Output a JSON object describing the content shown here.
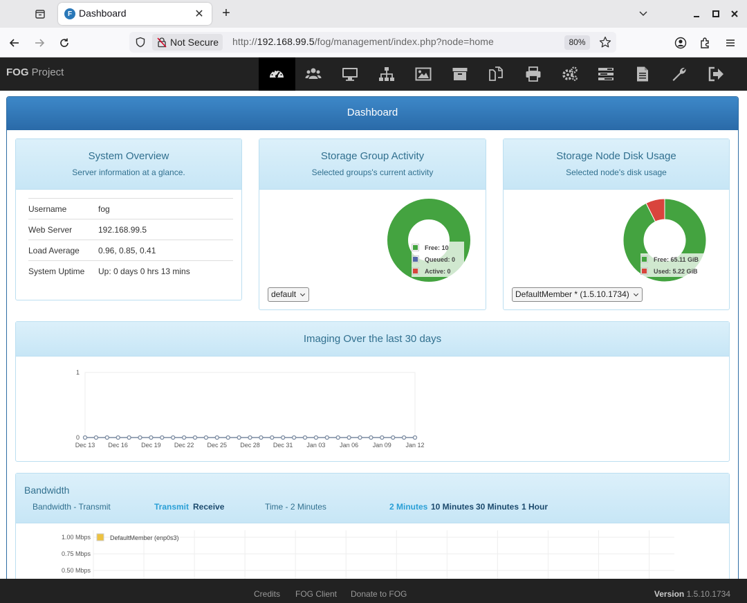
{
  "browser": {
    "tab_title": "Dashboard",
    "tab_favicon": "F",
    "not_secure_label": "Not Secure",
    "url_prefix": "http://",
    "url_host": "192.168.99.5",
    "url_path": "/fog/management/index.php?node=home",
    "zoom": "80%"
  },
  "header": {
    "brand_bold": "FOG",
    "brand_rest": " Project",
    "menu": [
      {
        "icon": "dashboard-icon",
        "active": true
      },
      {
        "icon": "users-icon"
      },
      {
        "icon": "hosts-icon"
      },
      {
        "icon": "groups-icon"
      },
      {
        "icon": "images-icon"
      },
      {
        "icon": "storage-icon"
      },
      {
        "icon": "snapins-icon"
      },
      {
        "icon": "printers-icon"
      },
      {
        "icon": "service-icon"
      },
      {
        "icon": "tasks-icon"
      },
      {
        "icon": "reports-icon"
      },
      {
        "icon": "settings-icon"
      },
      {
        "icon": "logout-icon"
      }
    ]
  },
  "dashboard": {
    "heading": "Dashboard",
    "system_overview": {
      "title": "System Overview",
      "subtitle": "Server information at a glance.",
      "rows": [
        {
          "key": "Username",
          "value": "fog"
        },
        {
          "key": "Web Server",
          "value": "192.168.99.5"
        },
        {
          "key": "Load Average",
          "value": "0.96, 0.85, 0.41"
        },
        {
          "key": "System Uptime",
          "value": "Up: 0 days 0 hrs 13 mins"
        }
      ]
    },
    "storage_group": {
      "title": "Storage Group Activity",
      "subtitle": "Selected groups's current activity",
      "select_value": "default",
      "legend": [
        "Free: 10",
        "Queued: 0",
        "Active: 0"
      ],
      "colors": [
        "#44a340",
        "#5566aa",
        "#d9443d"
      ]
    },
    "storage_node": {
      "title": "Storage Node Disk Usage",
      "subtitle": "Selected node's disk usage",
      "select_value": "DefaultMember * (1.5.10.1734)",
      "legend": [
        "Free: 65.11 GiB",
        "Used: 5.22 GiB"
      ],
      "colors": [
        "#44a340",
        "#d9443d"
      ]
    },
    "imaging": {
      "title": "Imaging Over the last 30 days"
    },
    "bandwidth": {
      "title": "Bandwidth",
      "label_transmit": "Bandwidth - Transmit",
      "link_transmit": "Transmit",
      "link_receive": "Receive",
      "label_time": "Time - 2 Minutes",
      "time_links": [
        "2 Minutes",
        "10 Minutes",
        "30 Minutes",
        "1 Hour"
      ],
      "legend_entry": "DefaultMember (enp0s3)",
      "legend_color": "#edc240",
      "y_ticks": [
        "1.00 Mbps",
        "0.75 Mbps",
        "0.50 Mbps"
      ]
    }
  },
  "chart_data": [
    {
      "type": "pie",
      "title": "Storage Group Activity",
      "labels": [
        "Free",
        "Queued",
        "Active"
      ],
      "values": [
        10,
        0,
        0
      ]
    },
    {
      "type": "pie",
      "title": "Storage Node Disk Usage",
      "labels": [
        "Free",
        "Used"
      ],
      "values": [
        65.11,
        5.22
      ],
      "unit": "GiB"
    },
    {
      "type": "line",
      "title": "Imaging Over the last 30 days",
      "x": [
        "Dec 13",
        "Dec 14",
        "Dec 15",
        "Dec 16",
        "Dec 17",
        "Dec 18",
        "Dec 19",
        "Dec 20",
        "Dec 21",
        "Dec 22",
        "Dec 23",
        "Dec 24",
        "Dec 25",
        "Dec 26",
        "Dec 27",
        "Dec 28",
        "Dec 29",
        "Dec 30",
        "Dec 31",
        "Jan 01",
        "Jan 02",
        "Jan 03",
        "Jan 04",
        "Jan 05",
        "Jan 06",
        "Jan 07",
        "Jan 08",
        "Jan 09",
        "Jan 10",
        "Jan 11",
        "Jan 12"
      ],
      "x_tick_labels": [
        "Dec 13",
        "Dec 16",
        "Dec 19",
        "Dec 22",
        "Dec 25",
        "Dec 28",
        "Dec 31",
        "Jan 03",
        "Jan 06",
        "Jan 09",
        "Jan 12"
      ],
      "y_tick_labels": [
        "0",
        "1"
      ],
      "values": [
        0,
        0,
        0,
        0,
        0,
        0,
        0,
        0,
        0,
        0,
        0,
        0,
        0,
        0,
        0,
        0,
        0,
        0,
        0,
        0,
        0,
        0,
        0,
        0,
        0,
        0,
        0,
        0,
        0,
        0,
        0
      ],
      "ylim": [
        0,
        1
      ]
    }
  ],
  "footer": {
    "links": [
      "Credits",
      "FOG Client",
      "Donate to FOG"
    ],
    "version_label": "Version",
    "version": "1.5.10.1734"
  }
}
